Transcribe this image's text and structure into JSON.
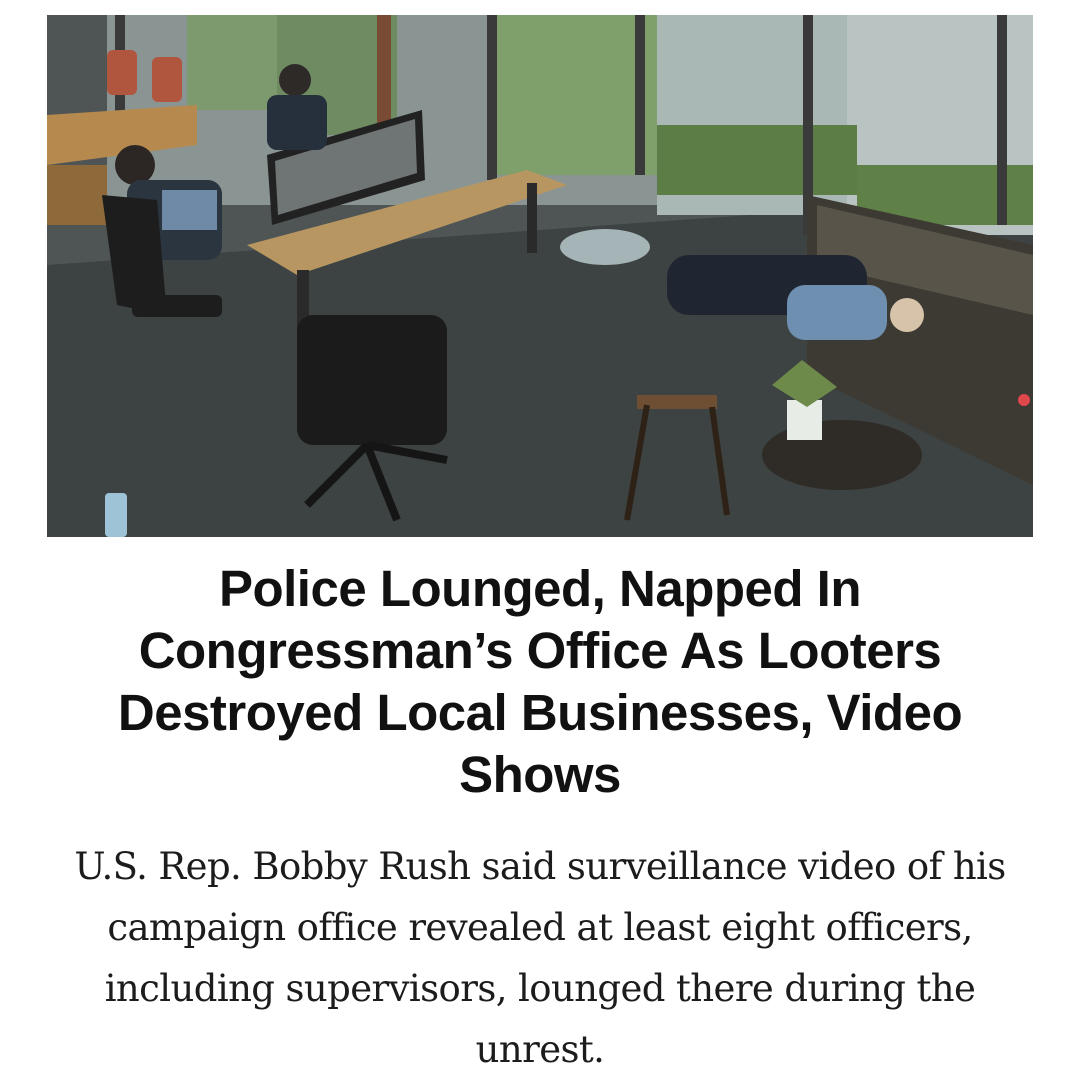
{
  "post": {
    "headline": "Police Lounged, Napped In Congressman’s Office As Looters Destroyed Local Businesses, Video Shows",
    "subheadline": "U.S. Rep. Bobby Rush said surveillance video of his campaign office revealed at least eight officers, including supervisors, lounged there during the unrest."
  },
  "photo": {
    "subject": "surveillance-still-campaign-office",
    "accent_marker_color": "#e0474c"
  }
}
